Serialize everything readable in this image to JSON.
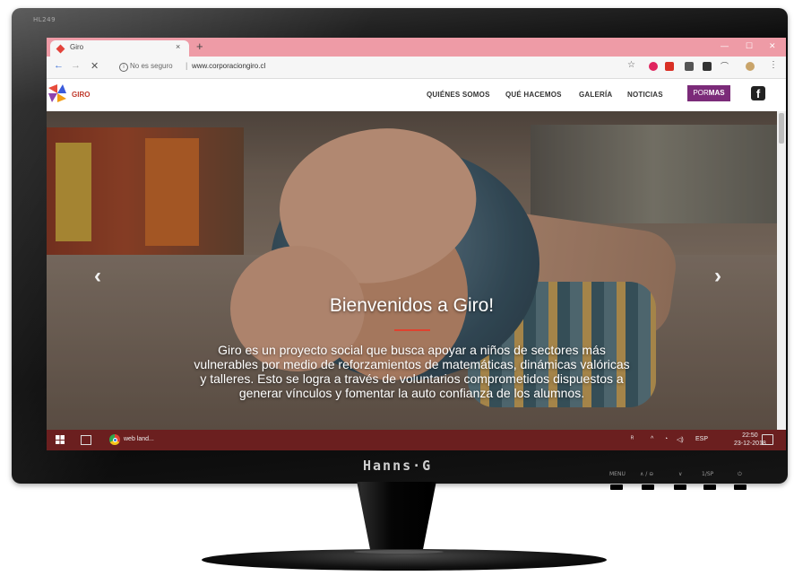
{
  "monitor": {
    "model_label": "HL249",
    "brand": "Hanns·G",
    "buttons": [
      "MENU",
      "∧ / ⊖",
      "∨",
      "1/SP",
      "⏻"
    ]
  },
  "browser": {
    "tab_title": "Giro",
    "tab_close": "×",
    "new_tab": "+",
    "security_text": "No es seguro",
    "url": "www.corporaciongiro.cl",
    "accent_color": "#ee9ba6"
  },
  "site": {
    "logo_text": "GIRO",
    "nav": [
      "QUIÉNES SOMOS",
      "QUÉ HACEMOS",
      "GALERÍA",
      "NOTICIAS"
    ],
    "cta_prefix": "POR",
    "cta_suffix": "MAS",
    "cta_color": "#7b2b79",
    "facebook": "f",
    "hero_title": "Bienvenidos a Giro!",
    "hero_text": "Giro es un proyecto social que busca apoyar a niños de sectores más vulnerables por medio de reforzamientos de matemáticas, dinámicas valóricas y talleres. Esto se logra a través de voluntarios comprometidos dispuestos a generar vínculos y fomentar la auto confianza de los alumnos.",
    "prev_arrow": "‹",
    "next_arrow": "›"
  },
  "taskbar": {
    "app_label": "web land...",
    "lang": "ESP",
    "time": "22:50",
    "date": "23-12-2018",
    "color": "#6b1f1f"
  }
}
